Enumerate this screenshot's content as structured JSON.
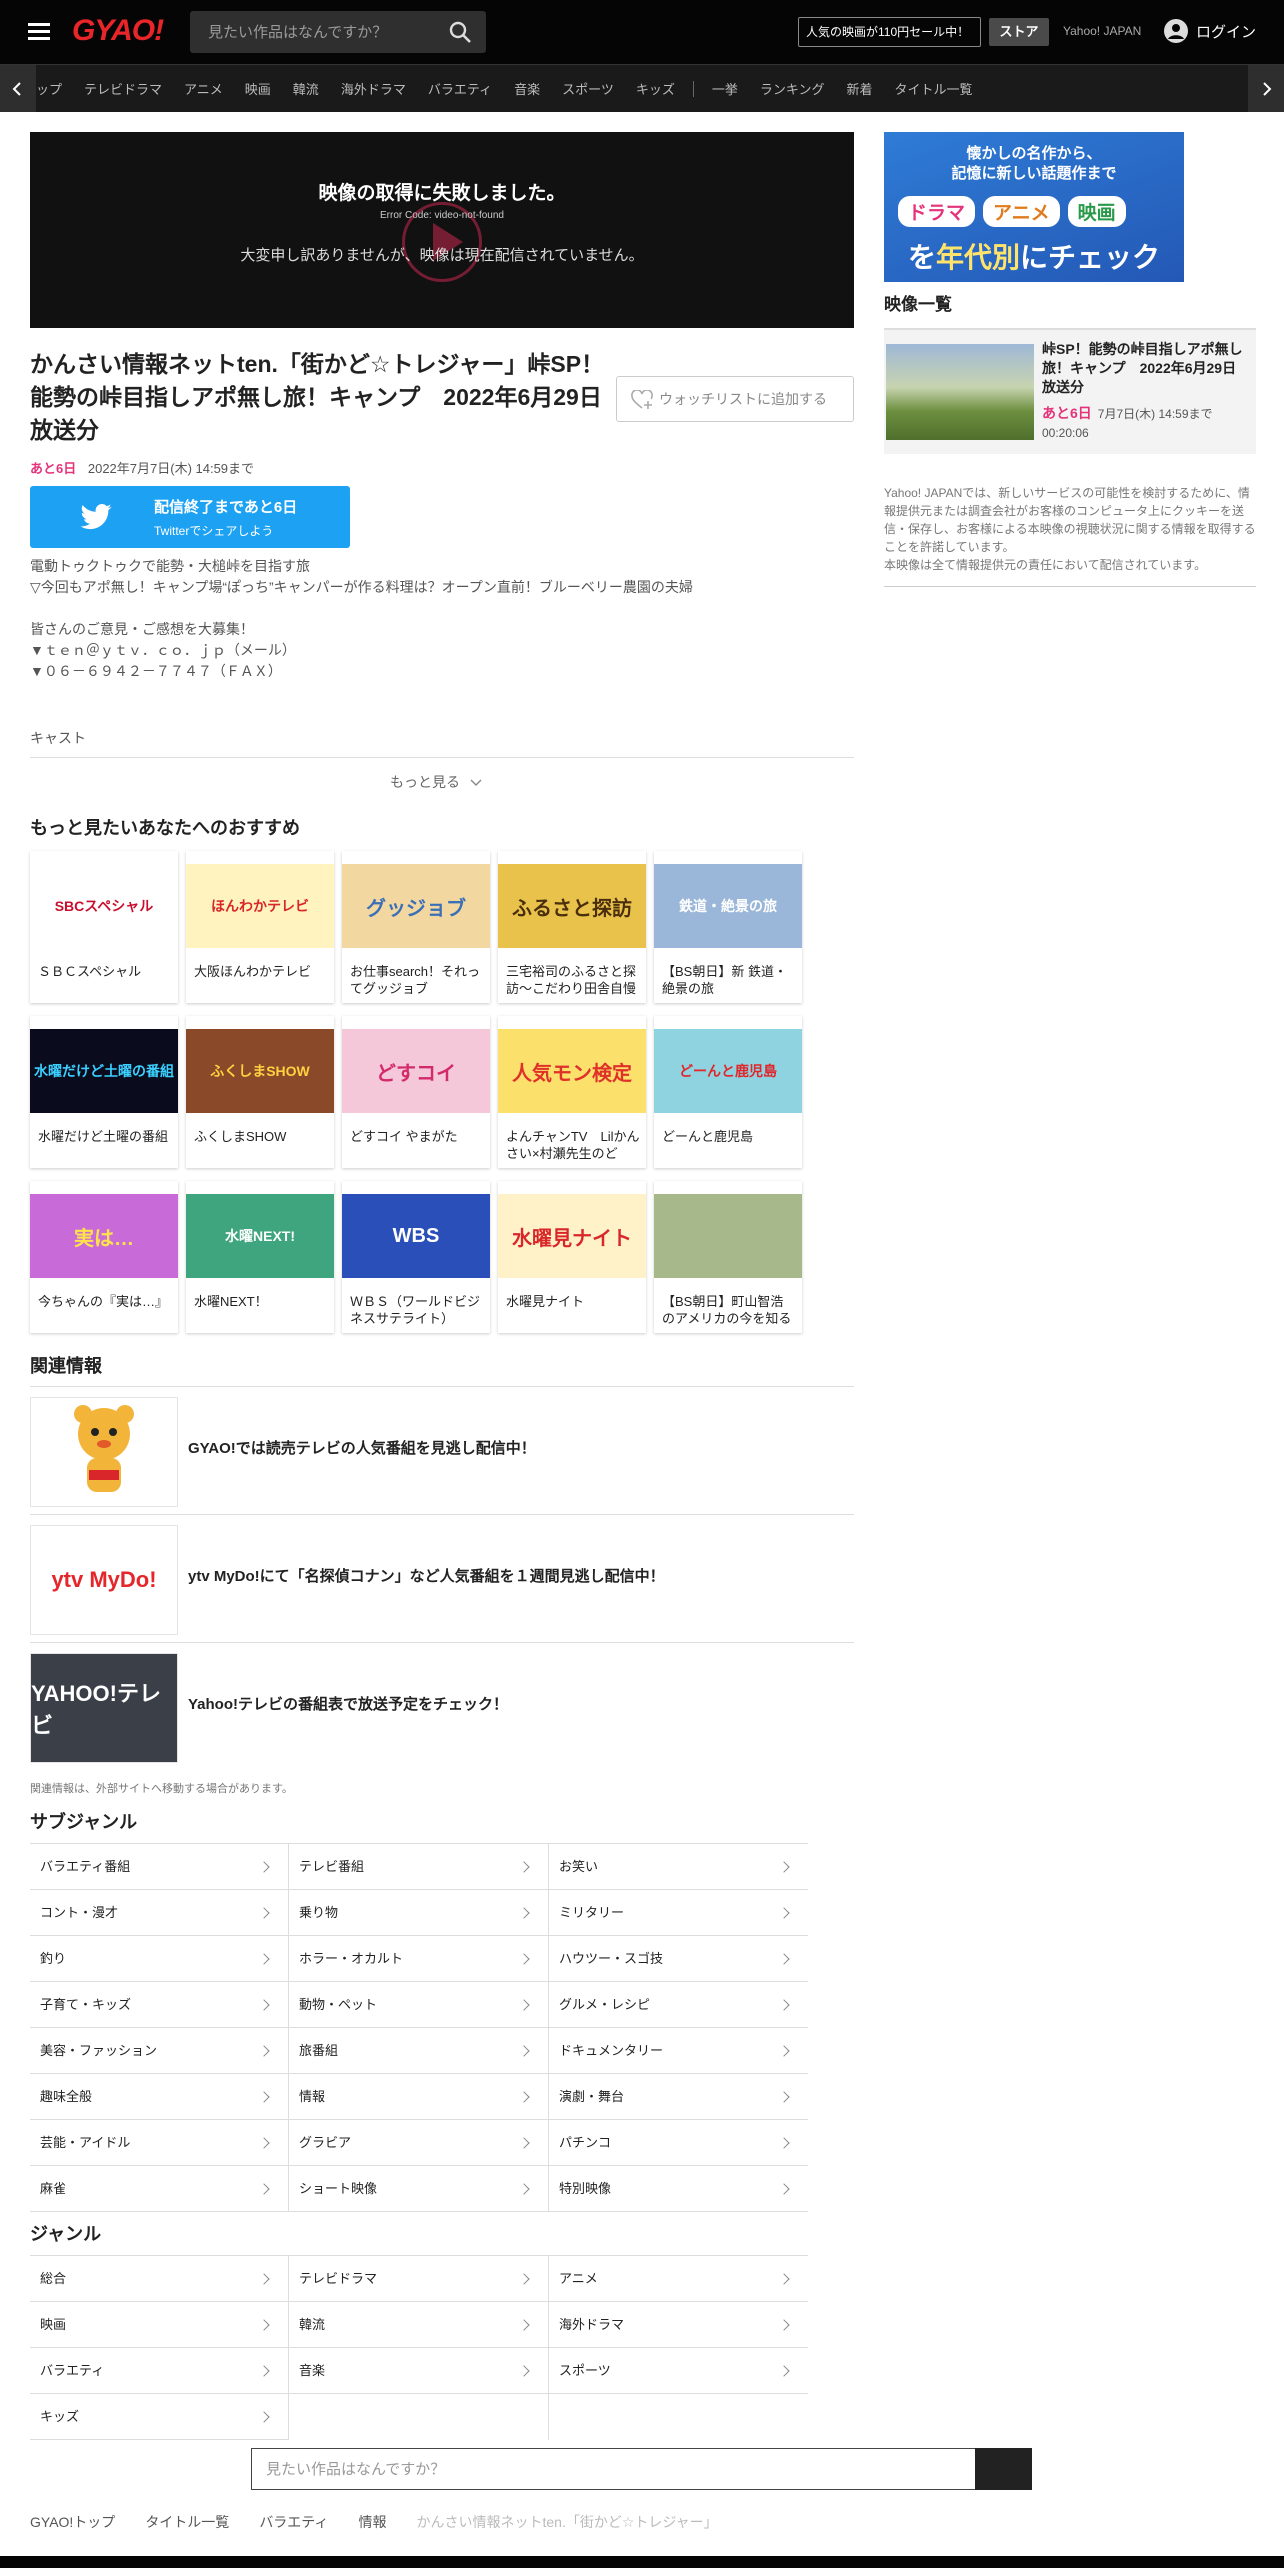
{
  "header": {
    "logo": "GYAO!",
    "search_placeholder": "見たい作品はなんですか？",
    "promo": "人気の映画が110円セール中！",
    "store": "ストア",
    "yahoo": "Yahoo! JAPAN",
    "login": "ログイン"
  },
  "nav": {
    "items": [
      "ップ",
      "テレビドラマ",
      "アニメ",
      "映画",
      "韓流",
      "海外ドラマ",
      "バラエティ",
      "音楽",
      "スポーツ",
      "キッズ",
      "一挙",
      "ランキング",
      "新着",
      "タイトル一覧"
    ]
  },
  "player": {
    "error_title": "映像の取得に失敗しました。",
    "error_code": "Error Code: video-not-found",
    "error_message": "大変申し訳ありませんが、映像は現在配信されていません。"
  },
  "program": {
    "title": "かんさい情報ネットten.「街かど☆トレジャー」峠SP！能勢の峠目指しアポ無し旅！キャンプ　2022年6月29日放送分",
    "watchlist": "ウォッチリストに追加する",
    "remaining": "あと6日",
    "end_date": "2022年7月7日(木) 14:59まで",
    "twitter_main": "配信終了まであと6日",
    "twitter_sub": "Twitterでシェアしよう",
    "description": "電動トゥクトゥクで能勢・大槌峠を目指す旅\n▽今回もアポ無し！キャンプ場“ぽっち”キャンパーが作る料理は？オープン直前！ブルーベリー農園の夫婦\n\n皆さんのご意見・ご感想を大募集！\n▼ｔｅｎ＠ｙｔｖ．ｃｏ．ｊｐ（メール）\n▼０６－６９４２－７７４７（ＦＡＸ）",
    "cast": "キャスト",
    "more": "もっと見る"
  },
  "recommend": {
    "heading": "もっと見たいあなたへのおすすめ",
    "items": [
      {
        "label": "ＳＢＣスペシャル",
        "thumb": "SBCスペシャル",
        "bg": "#ffffff",
        "fg": "#c8102e"
      },
      {
        "label": "大阪ほんわかテレビ",
        "thumb": "ほんわかテレビ",
        "bg": "#fff4c0",
        "fg": "#d9262a"
      },
      {
        "label": "お仕事search！それってグッジョブ",
        "thumb": "グッジョブ",
        "bg": "#f2d7a0",
        "fg": "#3b6fb6"
      },
      {
        "label": "三宅裕司のふるさと探訪～こだわり田舎自慢",
        "thumb": "ふるさと探訪",
        "bg": "#e8c24a",
        "fg": "#4a2e0e"
      },
      {
        "label": "【BS朝日】新 鉄道・絶景の旅",
        "thumb": "鉄道・絶景の旅",
        "bg": "#9ab6d8",
        "fg": "#ffffff"
      },
      {
        "label": "水曜だけど土曜の番組",
        "thumb": "水曜だけど土曜の番組",
        "bg": "#0b0b1e",
        "fg": "#3ad0ff"
      },
      {
        "label": "ふくしまSHOW",
        "thumb": "ふくしまSHOW",
        "bg": "#8a4a2a",
        "fg": "#ffd23f"
      },
      {
        "label": "どすコイ やまがた",
        "thumb": "どすコイ",
        "bg": "#f4c8d8",
        "fg": "#d22a6a"
      },
      {
        "label": "よんチャンTV　Lilかんさい×村瀬先生のど",
        "thumb": "人気モン検定",
        "bg": "#fbe16b",
        "fg": "#e0302a"
      },
      {
        "label": "どーんと鹿児島",
        "thumb": "どーんと鹿児島",
        "bg": "#8fd3e0",
        "fg": "#e0262a"
      },
      {
        "label": "今ちゃんの『実は…』",
        "thumb": "実は…",
        "bg": "#c86ad8",
        "fg": "#ffe34a"
      },
      {
        "label": "水曜NEXT！",
        "thumb": "水曜NEXT!",
        "bg": "#3fa57e",
        "fg": "#ffffff"
      },
      {
        "label": "ＷＢＳ（ワールドビジネスサテライト）",
        "thumb": "WBS",
        "bg": "#2a4fb8",
        "fg": "#ffffff"
      },
      {
        "label": "水曜見ナイト",
        "thumb": "水曜見ナイト",
        "bg": "#fff2c8",
        "fg": "#d9262a"
      },
      {
        "label": "【BS朝日】町山智浩のアメリカの今を知る",
        "thumb": "",
        "bg": "#a7b98a",
        "fg": "#ffffff"
      }
    ]
  },
  "related": {
    "heading": "関連情報",
    "items": [
      {
        "text": "GYAO!では読売テレビの人気番組を見逃し配信中！",
        "thumb": "",
        "bg": "#ffffff",
        "fg": "#e0a22a"
      },
      {
        "text": "ytv MyDo!にて「名探偵コナン」など人気番組を１週間見逃し配信中！",
        "thumb": "ytv MyDo!",
        "bg": "#ffffff",
        "fg": "#e5262a"
      },
      {
        "text": "Yahoo!テレビの番組表で放送予定をチェック！",
        "thumb": "YAHOO!テレビ",
        "bg": "#3a3f48",
        "fg": "#ffffff"
      }
    ],
    "note": "関連情報は、外部サイトへ移動する場合があります。"
  },
  "subgenre": {
    "heading": "サブジャンル",
    "items": [
      "バラエティ番組",
      "テレビ番組",
      "お笑い",
      "コント・漫才",
      "乗り物",
      "ミリタリー",
      "釣り",
      "ホラー・オカルト",
      "ハウツー・スゴ技",
      "子育て・キッズ",
      "動物・ペット",
      "グルメ・レシピ",
      "美容・ファッション",
      "旅番組",
      "ドキュメンタリー",
      "趣味全般",
      "情報",
      "演劇・舞台",
      "芸能・アイドル",
      "グラビア",
      "パチンコ",
      "麻雀",
      "ショート映像",
      "特別映像"
    ]
  },
  "genre": {
    "heading": "ジャンル",
    "items": [
      "総合",
      "テレビドラマ",
      "アニメ",
      "映画",
      "韓流",
      "海外ドラマ",
      "バラエティ",
      "音楽",
      "スポーツ",
      "キッズ"
    ]
  },
  "footer": {
    "search_placeholder": "見たい作品はなんですか？",
    "breadcrumb": [
      "GYAO!トップ",
      "タイトル一覧",
      "バラエティ",
      "情報",
      "かんさい情報ネットten.「街かど☆トレジャー」"
    ]
  },
  "sidebar": {
    "ad_text": "懐かしの名作から、\n記憶に新しい話題作まで",
    "ad_pills": [
      "ドラマ",
      "アニメ",
      "映画"
    ],
    "ad_catch_pre": "を",
    "ad_catch_em": "年代別",
    "ad_catch_post": "にチェック",
    "list_heading": "映像一覧",
    "card_title": "峠SP！能勢の峠目指しアポ無し旅！キャンプ　2022年6月29日放送分",
    "card_remaining": "あと6日",
    "card_end": "7月7日(木) 14:59まで",
    "card_duration": "00:20:06",
    "privacy": "Yahoo! JAPANでは、新しいサービスの可能性を検討するために、情報提供元または調査会社がお客様のコンピュータ上にクッキーを送信・保存し、お客様による本映像の視聴状況に関する情報を取得することを許諾しています。\n本映像は全て情報提供元の責任において配信されています。"
  }
}
